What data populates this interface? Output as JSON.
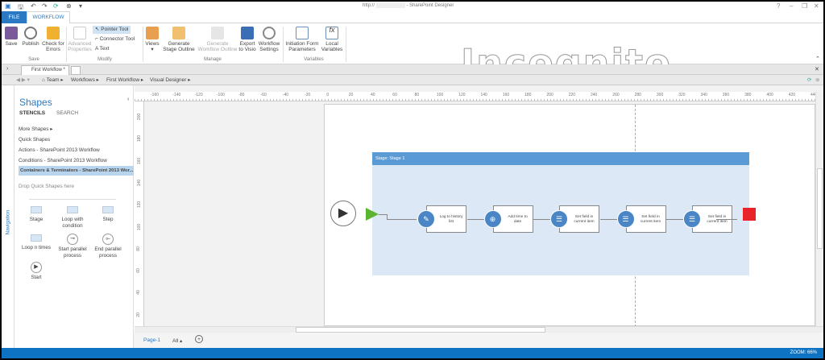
{
  "titlebar": {
    "url": "http://",
    "title": "- SharePoint Designer",
    "help": "?",
    "minimize": "–",
    "restore": "❐",
    "close": "✕"
  },
  "ribbon_tabs": [
    "FILE",
    "WORKFLOW"
  ],
  "ribbon": {
    "save": "Save",
    "publish": "Publish",
    "check": "Check for Errors",
    "group_save": "Save",
    "advanced": "Advanced Properties",
    "pointer": "Pointer Tool",
    "connector": "Connector Tool",
    "text": "Text",
    "group_modify": "Modify",
    "views": "Views",
    "gen_stage": "Generate Stage Outline",
    "gen_wf": "Generate Workflow Outline",
    "export": "Export to Visio",
    "wf_settings": "Workflow Settings",
    "group_manage": "Manage",
    "init_form": "Initiation Form Parameters",
    "local_vars": "Local Variables",
    "group_vars": "Variables"
  },
  "watermark": "Incognito",
  "doc_tab": "First Workflow *",
  "breadcrumb": [
    "Team",
    "Workflows",
    "First Workflow",
    "Visual Designer"
  ],
  "shapes": {
    "title": "Shapes",
    "stencils": "STENCILS",
    "search": "SEARCH",
    "items": [
      "More Shapes",
      "Quick Shapes",
      "Actions - SharePoint 2013 Workflow",
      "Conditions - SharePoint 2013 Workflow",
      "Containers & Terminators - SharePoint 2013 Wor..."
    ],
    "drop": "Drop Quick Shapes here",
    "stencil_shapes": [
      "Stage",
      "Loop with condition",
      "Step",
      "Loop n times",
      "Start parallel process",
      "End parallel process",
      "Start"
    ]
  },
  "navigation": "Navigation",
  "ruler": {
    "h": [
      "-160",
      "-140",
      "-120",
      "-100",
      "-80",
      "-60",
      "-40",
      "-20",
      "0",
      "20",
      "40",
      "60",
      "80",
      "100",
      "120",
      "140",
      "160",
      "180",
      "200",
      "220",
      "240",
      "260",
      "280",
      "300",
      "320",
      "340",
      "360",
      "380",
      "400",
      "420",
      "440"
    ],
    "v": [
      "200",
      "180",
      "160",
      "140",
      "120",
      "100",
      "80",
      "60",
      "40",
      "20"
    ]
  },
  "stage": {
    "label": "Stage:   Stage 1"
  },
  "actions": [
    "Log to history list",
    "Add time to date",
    "Set field in current item",
    "Set field in current item",
    "Set field in current item"
  ],
  "colors": {
    "accent": "#2b79c2",
    "stage_header": "#5b9bd5",
    "stage_body": "#dce8f5",
    "start_arrow": "#5cb531",
    "terminator": "#e8232a"
  },
  "bottom": {
    "page": "Page-1",
    "all": "All ▴",
    "add": "+"
  },
  "status": {
    "zoom": "ZOOM: 66%"
  }
}
